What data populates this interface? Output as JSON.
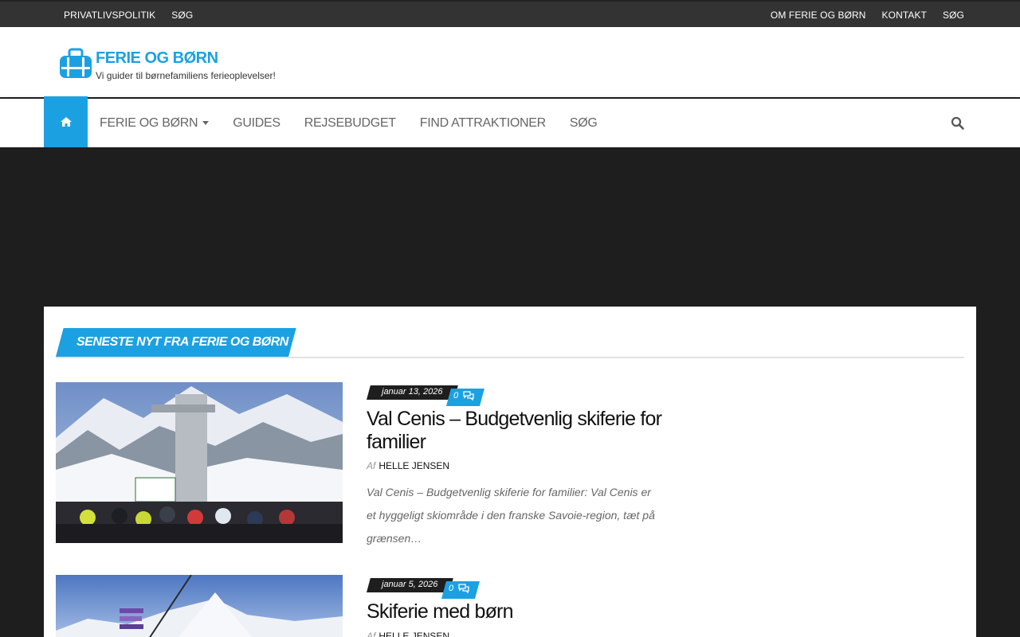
{
  "topbar": {
    "left_links": [
      "PRIVATLIVSPOLITIK",
      "SØG"
    ],
    "right_links": [
      "OM FERIE OG BØRN",
      "KONTAKT",
      "SØG"
    ]
  },
  "header": {
    "site_title": "FERIE OG BØRN",
    "tagline": "Vi guider til børnefamiliens ferieoplevelser!"
  },
  "nav": {
    "items": [
      "FERIE OG BØRN",
      "GUIDES",
      "REJSEBUDGET",
      "FIND ATTRAKTIONER",
      "SØG"
    ]
  },
  "section": {
    "title": "SENESTE NYT FRA FERIE OG BØRN"
  },
  "posts": [
    {
      "date": "januar 13, 2026",
      "comments": "0",
      "title": "Val Cenis – Budgetvenlig skiferie for familier",
      "by_label": "Af",
      "author": "HELLE JENSEN",
      "excerpt": "Val Cenis – Budgetvenlig skiferie for familier: Val Cenis er et hyggeligt skiområde i den franske Savoie-region, tæt på grænsen…"
    },
    {
      "date": "januar 5, 2026",
      "comments": "0",
      "title": "Skiferie med børn",
      "by_label": "Af",
      "author": "HELLE JENSEN"
    }
  ],
  "colors": {
    "accent": "#1ba1e2",
    "topbar": "#333333",
    "dark": "#1e1e1e"
  },
  "icons": {
    "home": "home-icon",
    "search": "search-icon",
    "comment": "comments-icon",
    "logo": "suitcase-icon"
  }
}
